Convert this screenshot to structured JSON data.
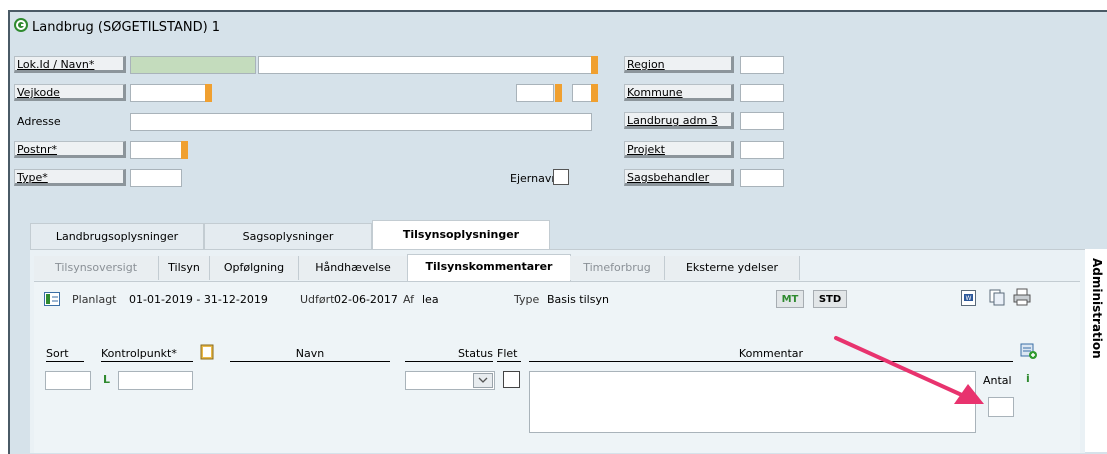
{
  "window": {
    "title": "Landbrug (SØGETILSTAND) 1"
  },
  "fields": {
    "lok_id_label": "Lok.Id / Navn*",
    "vejkode_label": "Vejkode",
    "adresse_label": "Adresse",
    "postnr_label": "Postnr*",
    "type_label": "Type*",
    "ejernavn_label": "Ejernavn"
  },
  "right_fields": {
    "region": "Region",
    "kommune": "Kommune",
    "landbrug_adm": "Landbrug adm 3",
    "projekt": "Projekt",
    "sagsbehandler": "Sagsbehandler"
  },
  "tabs": [
    "Landbrugsoplysninger",
    "Sagsoplysninger",
    "Tilsynsoplysninger"
  ],
  "subtabs": [
    "Tilsynsoversigt",
    "Tilsyn",
    "Opfølgning",
    "Håndhævelse",
    "Tilsynskommentarer",
    "Timeforbrug",
    "Eksterne ydelser"
  ],
  "info": {
    "planlagt_label": "Planlagt",
    "planlagt_value": "01-01-2019 - 31-12-2019",
    "udfoert_label": "Udført",
    "udfoert_value": "02-06-2017",
    "af_label": "Af",
    "af_value": "lea",
    "type_label": "Type",
    "type_value": "Basis tilsyn",
    "mt": "MT",
    "std": "STD"
  },
  "columns": {
    "sort": "Sort",
    "kontrolpunkt": "Kontrolpunkt*",
    "navn": "Navn",
    "status": "Status",
    "flet": "Flet",
    "kommentar": "Kommentar",
    "antal": "Antal",
    "l": "L",
    "info": "i"
  },
  "side_panel": "Administration",
  "colors": {
    "frame": "#d6e2ea",
    "accent_orange": "#f0a030",
    "arrow": "#e8336e",
    "mt_green": "#2f8a2f"
  }
}
